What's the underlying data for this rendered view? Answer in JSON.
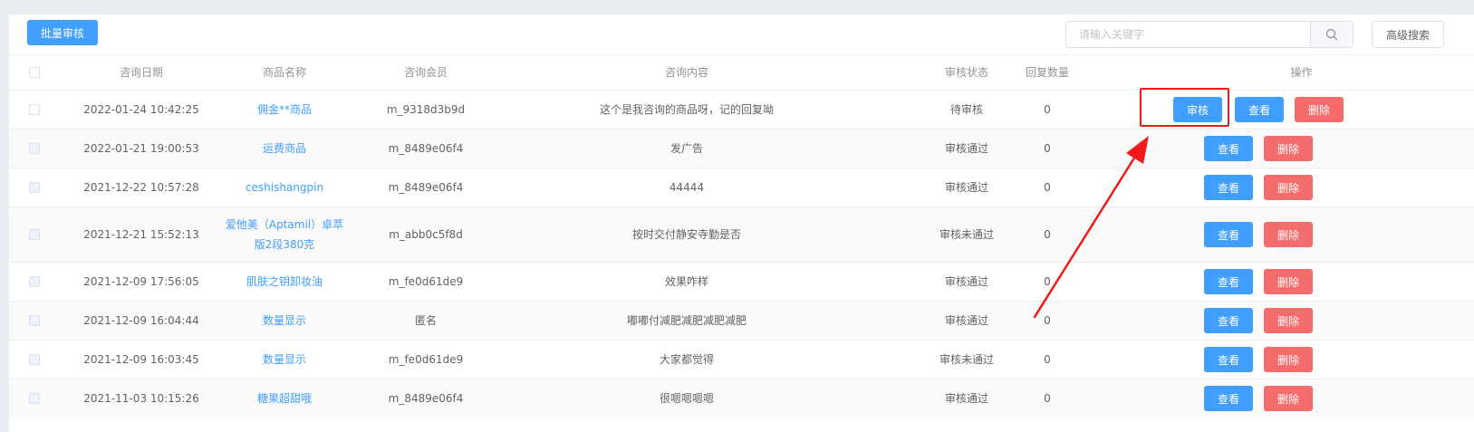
{
  "toolbar": {
    "batch_label": "批量审核",
    "search_placeholder": "请输入关键字",
    "search_value": "",
    "advanced_label": "高级搜索"
  },
  "table": {
    "headers": {
      "date": "咨询日期",
      "name": "商品名称",
      "member": "咨询会员",
      "content": "咨询内容",
      "status": "审核状态",
      "count": "回复数量",
      "ops": "操作"
    },
    "actions": {
      "review": "审核",
      "view": "查看",
      "delete": "删除"
    },
    "rows": [
      {
        "date": "2022-01-24 10:42:25",
        "name": "佣金**商品",
        "member": "m_9318d3b9d",
        "content": "这个是我咨询的商品呀，记的回复呦",
        "status": "待审核",
        "count": "0",
        "reviewable": true
      },
      {
        "date": "2022-01-21 19:00:53",
        "name": "运费商品",
        "member": "m_8489e06f4",
        "content": "发广告",
        "status": "审核通过",
        "count": "0",
        "reviewable": false
      },
      {
        "date": "2021-12-22 10:57:28",
        "name": "ceshishangpin",
        "member": "m_8489e06f4",
        "content": "44444",
        "status": "审核通过",
        "count": "0",
        "reviewable": false
      },
      {
        "date": "2021-12-21 15:52:13",
        "name": "爱他美（Aptamil）卓萃版2段380克",
        "member": "m_abb0c5f8d",
        "content": "按时交付静安寺勤是否",
        "status": "审核未通过",
        "count": "0",
        "reviewable": false
      },
      {
        "date": "2021-12-09 17:56:05",
        "name": "肌肤之钥卸妆油",
        "member": "m_fe0d61de9",
        "content": "效果咋样",
        "status": "审核通过",
        "count": "0",
        "reviewable": false
      },
      {
        "date": "2021-12-09 16:04:44",
        "name": "数量显示",
        "member": "匿名",
        "content": "嘟嘟付减肥减肥减肥减肥",
        "status": "审核通过",
        "count": "0",
        "reviewable": false
      },
      {
        "date": "2021-12-09 16:03:45",
        "name": "数量显示",
        "member": "m_fe0d61de9",
        "content": "大家都觉得",
        "status": "审核未通过",
        "count": "0",
        "reviewable": false
      },
      {
        "date": "2021-11-03 10:15:26",
        "name": "糖果超甜哦",
        "member": "m_8489e06f4",
        "content": "很嗯嗯嗯嗯",
        "status": "审核通过",
        "count": "0",
        "reviewable": false
      }
    ]
  },
  "colors": {
    "primary": "#409eff",
    "danger": "#f56c6c",
    "annotation": "#f01919"
  }
}
